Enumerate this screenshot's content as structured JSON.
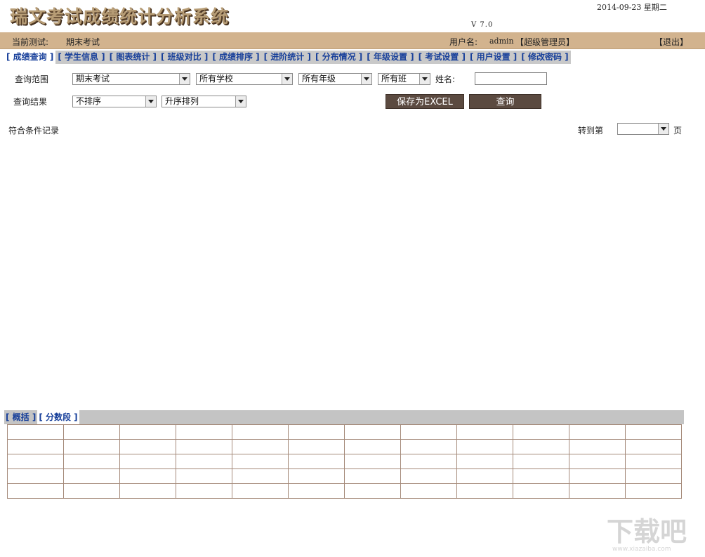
{
  "header": {
    "app_title": "瑞文考试成绩统计分析系统",
    "date": "2014-09-23 星期二",
    "version": "V 7.0"
  },
  "info_bar": {
    "current_test_label": "当前测试:",
    "current_test_value": "期末考试",
    "username_label": "用户名:",
    "username_value": "admin",
    "role": "【超级管理员】",
    "logout": "【退出】"
  },
  "tabs": [
    {
      "label": "[ 成绩查询 ]",
      "active": true
    },
    {
      "label": "[ 学生信息 ]",
      "active": false
    },
    {
      "label": "[ 图表统计 ]",
      "active": false
    },
    {
      "label": "[ 班级对比 ]",
      "active": false
    },
    {
      "label": "[ 成绩排序 ]",
      "active": false
    },
    {
      "label": "[ 进阶统计 ]",
      "active": false
    },
    {
      "label": "[ 分布情况 ]",
      "active": false
    },
    {
      "label": "[ 年级设置 ]",
      "active": false
    },
    {
      "label": "[ 考试设置 ]",
      "active": false
    },
    {
      "label": "[ 用户设置 ]",
      "active": false
    },
    {
      "label": "[ 修改密码 ]",
      "active": false
    }
  ],
  "query": {
    "range_label": "查询范围",
    "exam_select": "期末考试",
    "school_select": "所有学校",
    "grade_select": "所有年级",
    "class_select": "所有班",
    "name_label": "姓名:",
    "name_value": "",
    "result_label": "查询结果",
    "sort_select": "不排序",
    "order_select": "升序排列",
    "save_excel_button": "保存为EXCEL",
    "query_button": "查询"
  },
  "records": {
    "matching_label": "符合条件记录",
    "goto_label": "转到第",
    "page_select": "",
    "page_suffix": "页"
  },
  "bottom_tabs": [
    {
      "label": "[ 概括 ]",
      "active": false
    },
    {
      "label": "[ 分数段 ]",
      "active": true
    }
  ],
  "score_table": {
    "rows": [
      [
        "",
        "",
        "",
        "",
        "",
        "",
        "",
        "",
        "",
        "",
        "",
        ""
      ],
      [
        "",
        "",
        "",
        "",
        "",
        "",
        "",
        "",
        "",
        "",
        "",
        ""
      ],
      [
        "",
        "",
        "",
        "",
        "",
        "",
        "",
        "",
        "",
        "",
        "",
        ""
      ],
      [
        "",
        "",
        "",
        "",
        "",
        "",
        "",
        "",
        "",
        "",
        "",
        ""
      ],
      [
        "",
        "",
        "",
        "",
        "",
        "",
        "",
        "",
        "",
        "",
        "",
        ""
      ]
    ]
  },
  "watermark": {
    "text": "下载吧",
    "sub": "www.xiazaiba.com"
  }
}
